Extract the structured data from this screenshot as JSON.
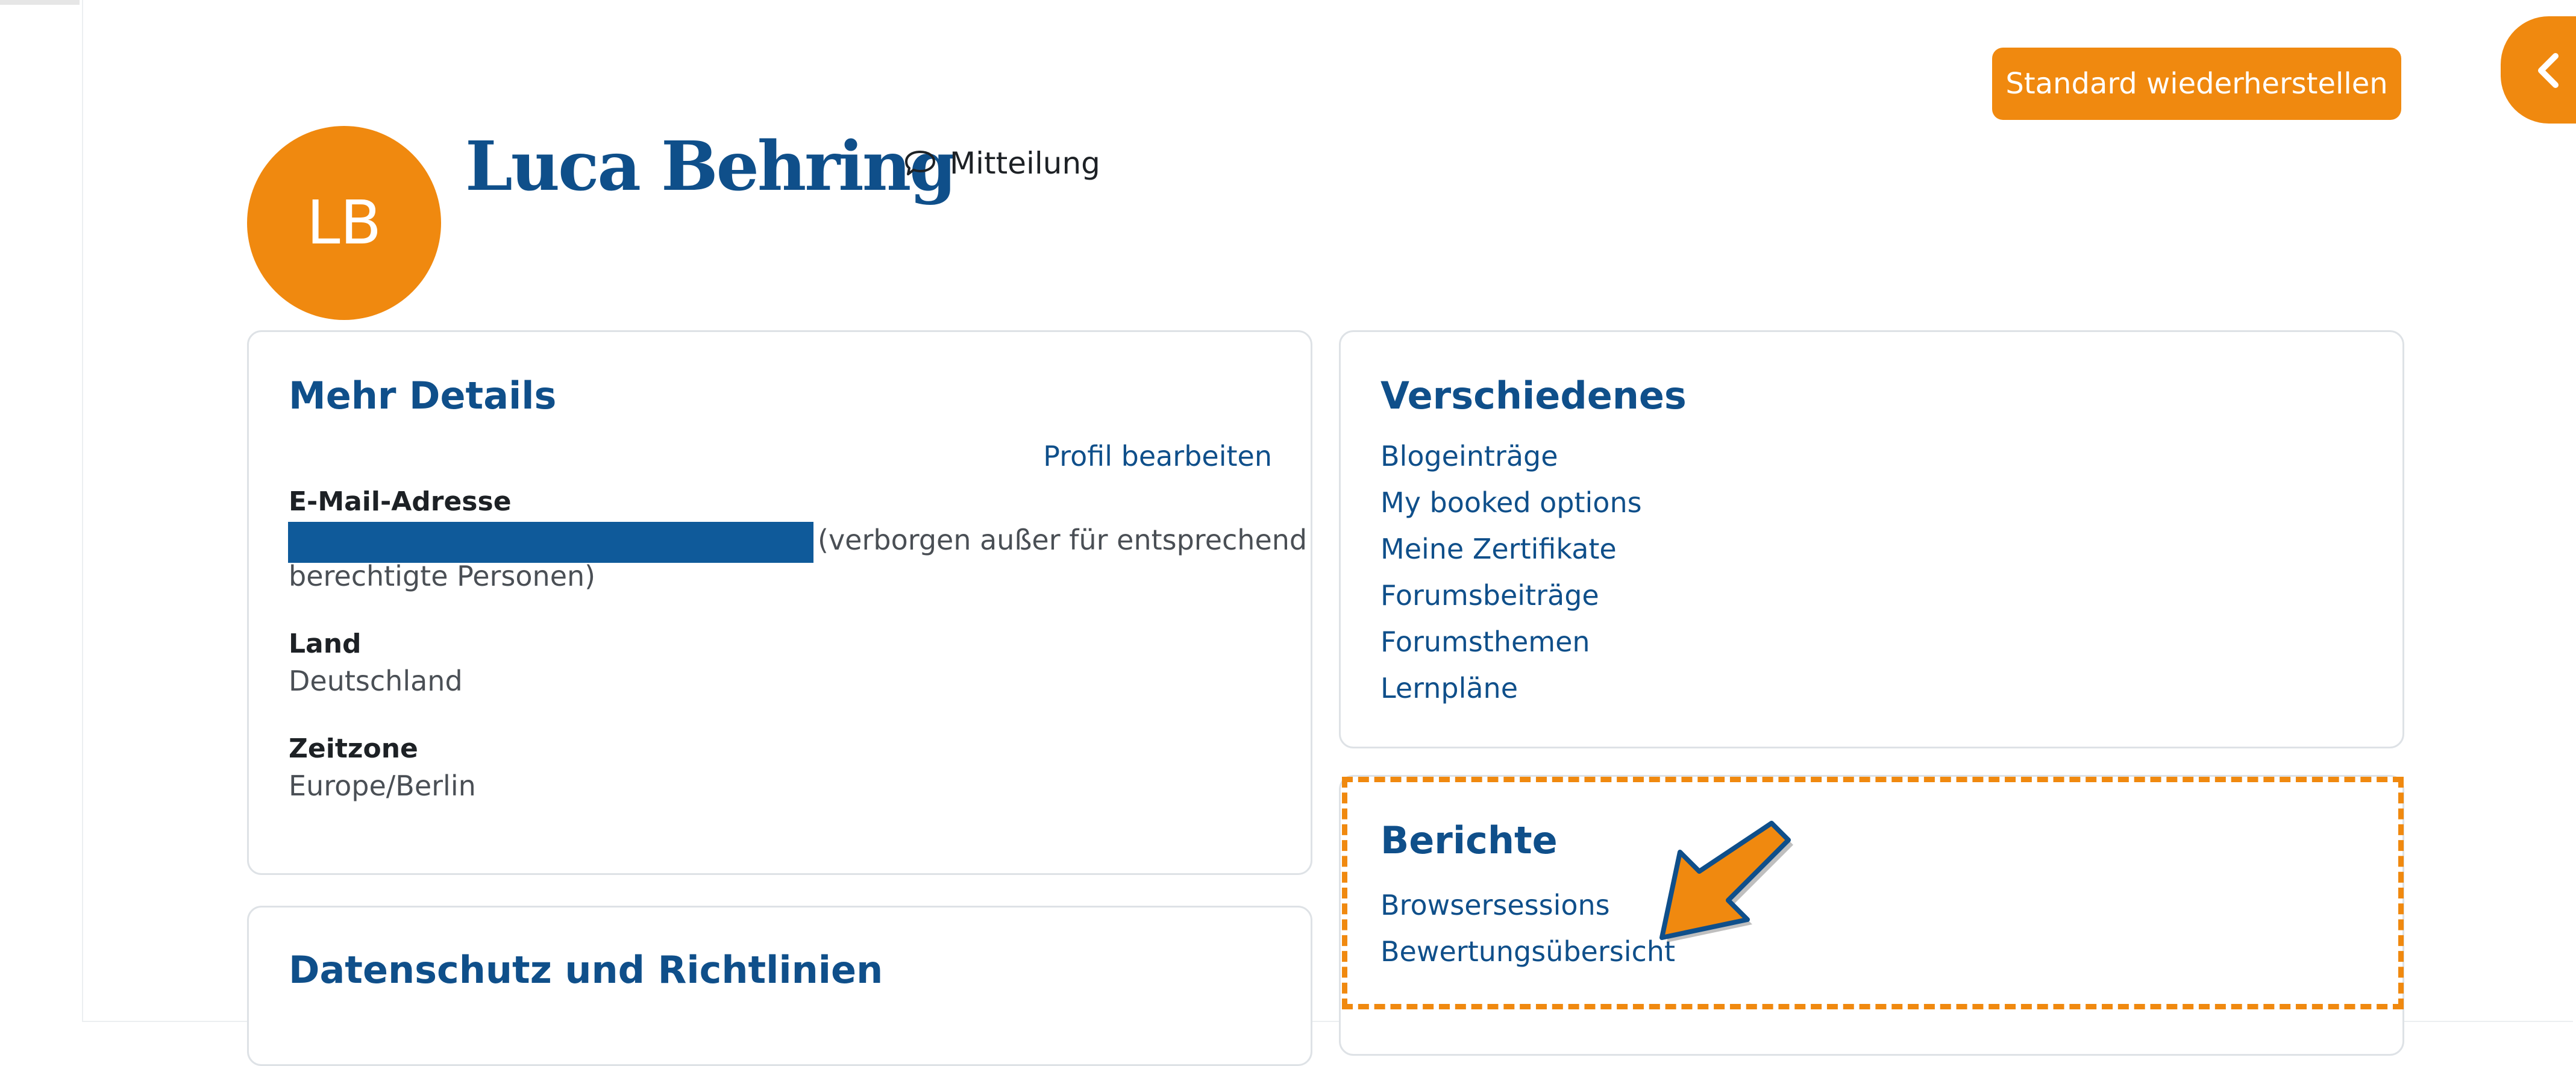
{
  "header": {
    "reset_button_label": "Standard wiederherstellen",
    "drawer_toggle_icon": "chevron-left-icon"
  },
  "profile": {
    "initials": "LB",
    "name": "Luca Behring",
    "message_icon": "speech-bubble-icon",
    "message_label": "Mitteilung"
  },
  "details": {
    "title": "Mehr Details",
    "edit_link": "Profil bearbeiten",
    "email_label": "E-Mail-Adresse",
    "email_note_line1": "(verborgen außer für entsprechend",
    "email_note_line2": "berechtigte Personen)",
    "country_label": "Land",
    "country_value": "Deutschland",
    "timezone_label": "Zeitzone",
    "timezone_value": "Europe/Berlin"
  },
  "privacy": {
    "title": "Datenschutz und Richtlinien"
  },
  "misc": {
    "title": "Verschiedenes",
    "links": [
      "Blogeinträge",
      "My booked options",
      "Meine Zertifikate",
      "Forumsbeiträge",
      "Forumsthemen",
      "Lernpläne"
    ]
  },
  "reports": {
    "title": "Berichte",
    "links": [
      "Browsersessions",
      "Bewertungsübersicht"
    ]
  },
  "colors": {
    "accent": "#f0890f",
    "brand_blue": "#0f4f8a"
  }
}
